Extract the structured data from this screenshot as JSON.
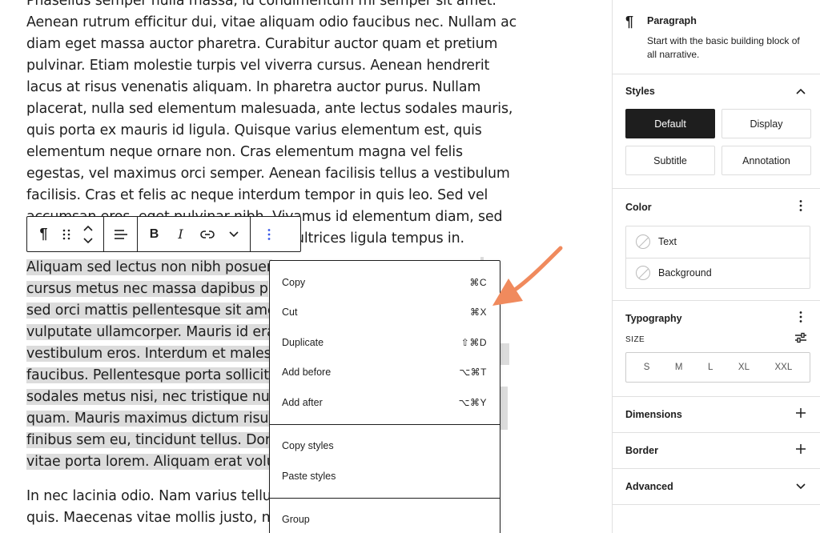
{
  "editor": {
    "paragraph1_lines": [
      "Phasellus semper nulla massa, id condimentum mi semper sit amet.",
      "Aenean rutrum efficitur dui, vitae aliquam odio faucibus nec. Nullam ac",
      "diam eget massa auctor pharetra. Curabitur auctor quam et pretium",
      "pulvinar. Etiam molestie turpis vel viverra cursus. Aenean hendrerit",
      "lacus at risus venenatis aliquam. In pharetra auctor purus. Nullam",
      "placerat, nulla sed elementum malesuada, ante lectus sodales mauris,",
      "quis porta ex mauris id ligula. Quisque varius elementum est, quis",
      "elementum neque ornare non. Cras elementum magna vel felis",
      "egestas, vel maximus orci semper. Aenean facilisis tellus a vestibulum",
      "facilisis. Cras et felis ac neque interdum tempor in quis leo. Sed vel",
      "accumsan eros, eget pulvinar nibh. Vivamus id elementum diam, sed",
      "ultrices ligula tempus in."
    ],
    "paragraph2_lines": [
      "Aliquam sed lectus non nibh posuer",
      "cursus metus nec massa dapibus p",
      "sed orci mattis pellentesque sit ame",
      "vulputate ullamcorper. Mauris id era",
      "vestibulum eros. Interdum et malesu",
      "faucibus. Pellentesque porta sollicit",
      "sodales metus nisi, nec tristique nu",
      "quam. Mauris maximus dictum risus",
      "finibus sem eu, tincidunt tellus. Don",
      "vitae porta lorem. Aliquam erat volut"
    ],
    "paragraph3_lines": [
      "In nec lacinia odio. Nam varius tellus",
      "quis. Maecenas vitae mollis justo, ne"
    ]
  },
  "toolbar": {
    "paragraph_glyph": "¶",
    "bold": "B",
    "italic": "I"
  },
  "menu": {
    "section1": [
      {
        "label": "Copy",
        "shortcut": "⌘C"
      },
      {
        "label": "Cut",
        "shortcut": "⌘X"
      },
      {
        "label": "Duplicate",
        "shortcut": "⇧⌘D"
      },
      {
        "label": "Add before",
        "shortcut": "⌥⌘T"
      },
      {
        "label": "Add after",
        "shortcut": "⌥⌘Y"
      }
    ],
    "section2": [
      {
        "label": "Copy styles"
      },
      {
        "label": "Paste styles"
      }
    ],
    "section3": [
      {
        "label": "Group"
      }
    ]
  },
  "sidebar": {
    "block": {
      "icon_glyph": "¶",
      "title": "Paragraph",
      "description": "Start with the basic building block of all narrative."
    },
    "styles": {
      "title": "Styles",
      "options": [
        "Default",
        "Display",
        "Subtitle",
        "Annotation"
      ],
      "active": "Default"
    },
    "color": {
      "title": "Color",
      "items": [
        "Text",
        "Background"
      ]
    },
    "typography": {
      "title": "Typography",
      "size_label": "SIZE",
      "sizes": [
        "S",
        "M",
        "L",
        "XL",
        "XXL"
      ]
    },
    "dimensions": {
      "title": "Dimensions"
    },
    "border": {
      "title": "Border"
    },
    "advanced": {
      "title": "Advanced"
    }
  },
  "colors": {
    "annotation_arrow": "#f08a5d",
    "active_style_bg": "#1e1e1e",
    "selection_bg": "#dcdcdc"
  }
}
